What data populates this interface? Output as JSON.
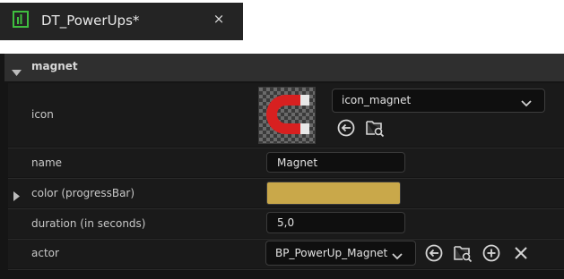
{
  "tab": {
    "title": "DT_PowerUps*",
    "close_glyph": "×",
    "icon": "data-table-icon",
    "accent": "#3fbf3f"
  },
  "category": {
    "label": "magnet"
  },
  "rows": {
    "icon": {
      "label": "icon",
      "asset_name": "icon_magnet",
      "thumbnail": "magnet-thumbnail"
    },
    "name": {
      "label": "name",
      "value": "Magnet"
    },
    "color": {
      "label": "color (progressBar)",
      "swatch": "#c9a84a"
    },
    "duration": {
      "label": "duration (in seconds)",
      "value": "5,0"
    },
    "actor": {
      "label": "actor",
      "class_name": "BP_PowerUp_Magnet"
    }
  },
  "colors": {
    "panel_bg": "#151515",
    "row_bg": "#1a1a1a",
    "header_bg": "#2f2f2f"
  }
}
